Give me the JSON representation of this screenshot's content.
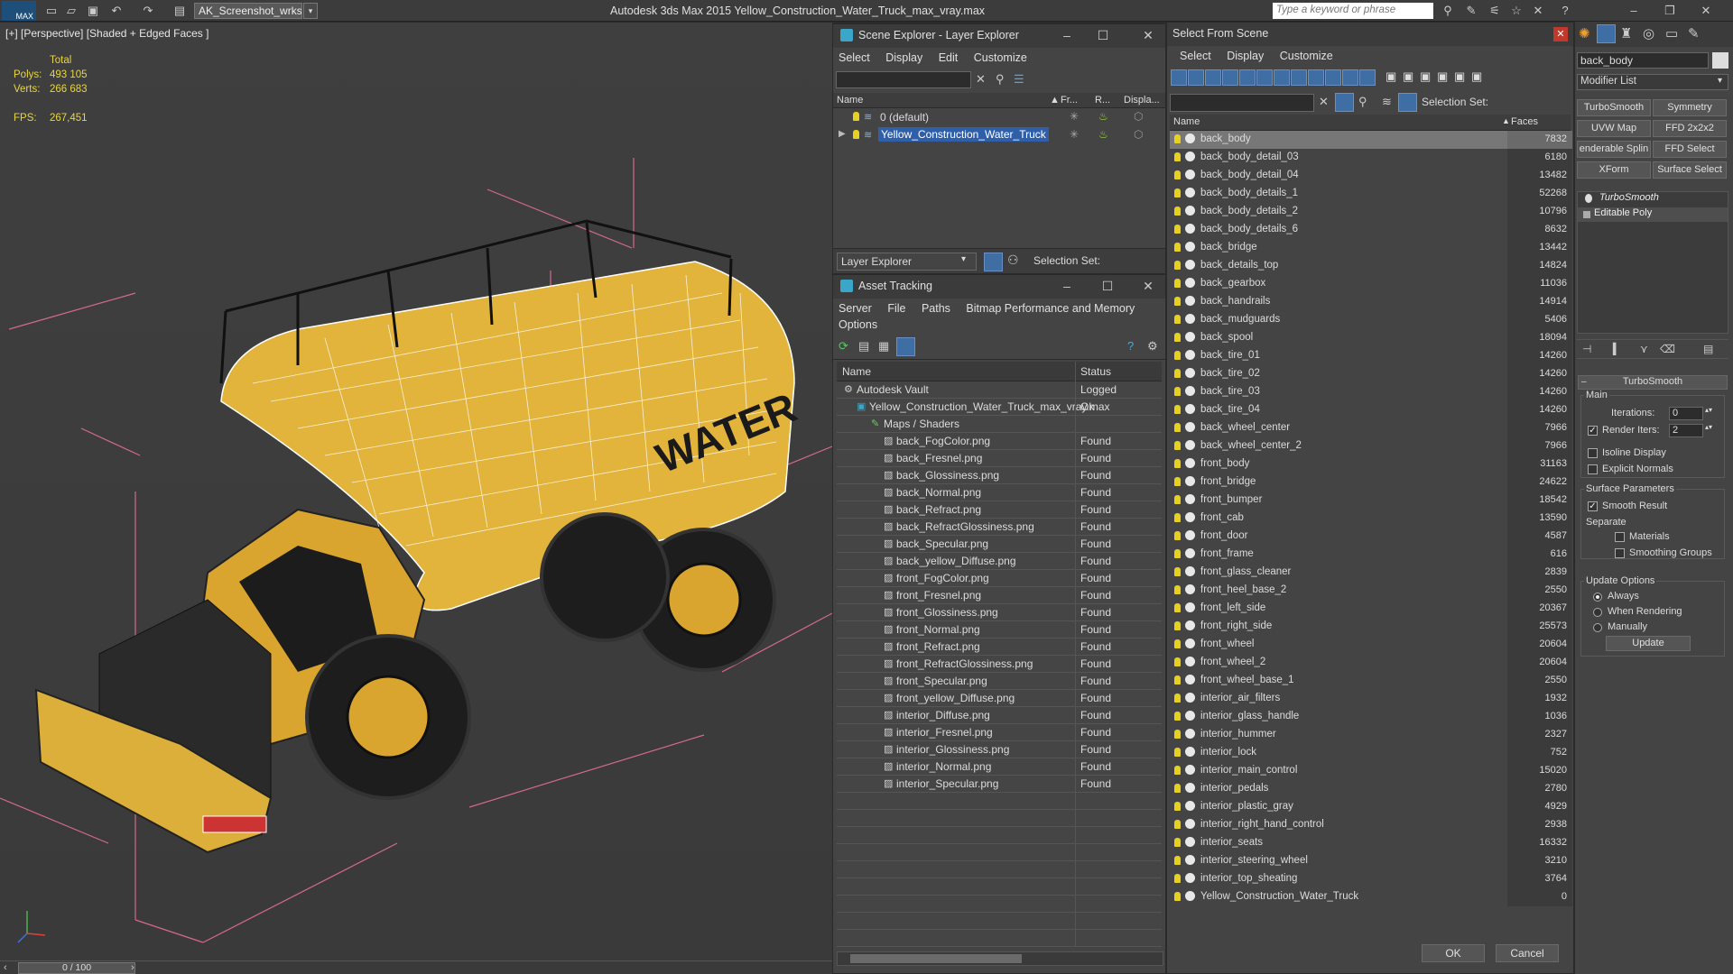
{
  "titlebar": {
    "logo_text": "MAX",
    "workspace": "AK_Screenshot_wrksp",
    "title": "Autodesk 3ds Max  2015     Yellow_Construction_Water_Truck_max_vray.max",
    "search_placeholder": "Type a keyword or phrase"
  },
  "viewport": {
    "label": "[+] [Perspective] [Shaded + Edged Faces ]",
    "stats": {
      "total_label": "Total",
      "polys_label": "Polys:",
      "polys": "493 105",
      "verts_label": "Verts:",
      "verts": "266 683",
      "fps_label": "FPS:",
      "fps": "267,451"
    },
    "tank_text": "WATER"
  },
  "timeline": {
    "frame": "0 / 100"
  },
  "scene_explorer": {
    "title": "Scene Explorer - Layer Explorer",
    "menu": [
      "Select",
      "Display",
      "Edit",
      "Customize"
    ],
    "columns": {
      "name": "Name",
      "freeze": "Fr...",
      "render": "R...",
      "display": "Displa..."
    },
    "rows": [
      {
        "name": "0 (default)",
        "selected": false
      },
      {
        "name": "Yellow_Construction_Water_Truck",
        "selected": true
      }
    ],
    "footer_dropdown": "Layer Explorer",
    "selection_set_label": "Selection Set:"
  },
  "asset_tracking": {
    "title": "Asset Tracking",
    "menu": [
      "Server",
      "File",
      "Paths",
      "Bitmap Performance and Memory",
      "Options"
    ],
    "columns": {
      "name": "Name",
      "status": "Status"
    },
    "rows": [
      {
        "name": "Autodesk Vault",
        "status": "Logged",
        "level": 0
      },
      {
        "name": "Yellow_Construction_Water_Truck_max_vray.max",
        "status": "Ok",
        "level": 1
      },
      {
        "name": "Maps / Shaders",
        "status": "",
        "level": 2
      },
      {
        "name": "back_FogColor.png",
        "status": "Found",
        "level": 3
      },
      {
        "name": "back_Fresnel.png",
        "status": "Found",
        "level": 3
      },
      {
        "name": "back_Glossiness.png",
        "status": "Found",
        "level": 3
      },
      {
        "name": "back_Normal.png",
        "status": "Found",
        "level": 3
      },
      {
        "name": "back_Refract.png",
        "status": "Found",
        "level": 3
      },
      {
        "name": "back_RefractGlossiness.png",
        "status": "Found",
        "level": 3
      },
      {
        "name": "back_Specular.png",
        "status": "Found",
        "level": 3
      },
      {
        "name": "back_yellow_Diffuse.png",
        "status": "Found",
        "level": 3
      },
      {
        "name": "front_FogColor.png",
        "status": "Found",
        "level": 3
      },
      {
        "name": "front_Fresnel.png",
        "status": "Found",
        "level": 3
      },
      {
        "name": "front_Glossiness.png",
        "status": "Found",
        "level": 3
      },
      {
        "name": "front_Normal.png",
        "status": "Found",
        "level": 3
      },
      {
        "name": "front_Refract.png",
        "status": "Found",
        "level": 3
      },
      {
        "name": "front_RefractGlossiness.png",
        "status": "Found",
        "level": 3
      },
      {
        "name": "front_Specular.png",
        "status": "Found",
        "level": 3
      },
      {
        "name": "front_yellow_Diffuse.png",
        "status": "Found",
        "level": 3
      },
      {
        "name": "interior_Diffuse.png",
        "status": "Found",
        "level": 3
      },
      {
        "name": "interior_Fresnel.png",
        "status": "Found",
        "level": 3
      },
      {
        "name": "interior_Glossiness.png",
        "status": "Found",
        "level": 3
      },
      {
        "name": "interior_Normal.png",
        "status": "Found",
        "level": 3
      },
      {
        "name": "interior_Specular.png",
        "status": "Found",
        "level": 3
      }
    ]
  },
  "select_from_scene": {
    "title": "Select From Scene",
    "menu": [
      "Select",
      "Display",
      "Customize"
    ],
    "selection_set_label": "Selection Set:",
    "columns": {
      "name": "Name",
      "faces": "Faces"
    },
    "rows": [
      {
        "name": "back_body",
        "faces": "7832"
      },
      {
        "name": "back_body_detail_03",
        "faces": "6180"
      },
      {
        "name": "back_body_detail_04",
        "faces": "13482"
      },
      {
        "name": "back_body_details_1",
        "faces": "52268"
      },
      {
        "name": "back_body_details_2",
        "faces": "10796"
      },
      {
        "name": "back_body_details_6",
        "faces": "8632"
      },
      {
        "name": "back_bridge",
        "faces": "13442"
      },
      {
        "name": "back_details_top",
        "faces": "14824"
      },
      {
        "name": "back_gearbox",
        "faces": "11036"
      },
      {
        "name": "back_handrails",
        "faces": "14914"
      },
      {
        "name": "back_mudguards",
        "faces": "5406"
      },
      {
        "name": "back_spool",
        "faces": "18094"
      },
      {
        "name": "back_tire_01",
        "faces": "14260"
      },
      {
        "name": "back_tire_02",
        "faces": "14260"
      },
      {
        "name": "back_tire_03",
        "faces": "14260"
      },
      {
        "name": "back_tire_04",
        "faces": "14260"
      },
      {
        "name": "back_wheel_center",
        "faces": "7966"
      },
      {
        "name": "back_wheel_center_2",
        "faces": "7966"
      },
      {
        "name": "front_body",
        "faces": "31163"
      },
      {
        "name": "front_bridge",
        "faces": "24622"
      },
      {
        "name": "front_bumper",
        "faces": "18542"
      },
      {
        "name": "front_cab",
        "faces": "13590"
      },
      {
        "name": "front_door",
        "faces": "4587"
      },
      {
        "name": "front_frame",
        "faces": "616"
      },
      {
        "name": "front_glass_cleaner",
        "faces": "2839"
      },
      {
        "name": "front_heel_base_2",
        "faces": "2550"
      },
      {
        "name": "front_left_side",
        "faces": "20367"
      },
      {
        "name": "front_right_side",
        "faces": "25573"
      },
      {
        "name": "front_wheel",
        "faces": "20604"
      },
      {
        "name": "front_wheel_2",
        "faces": "20604"
      },
      {
        "name": "front_wheel_base_1",
        "faces": "2550"
      },
      {
        "name": "interior_air_filters",
        "faces": "1932"
      },
      {
        "name": "interior_glass_handle",
        "faces": "1036"
      },
      {
        "name": "interior_hummer",
        "faces": "2327"
      },
      {
        "name": "interior_lock",
        "faces": "752"
      },
      {
        "name": "interior_main_control",
        "faces": "15020"
      },
      {
        "name": "interior_pedals",
        "faces": "2780"
      },
      {
        "name": "interior_plastic_gray",
        "faces": "4929"
      },
      {
        "name": "interior_right_hand_control",
        "faces": "2938"
      },
      {
        "name": "interior_seats",
        "faces": "16332"
      },
      {
        "name": "interior_steering_wheel",
        "faces": "3210"
      },
      {
        "name": "interior_top_sheating",
        "faces": "3764"
      },
      {
        "name": "Yellow_Construction_Water_Truck",
        "faces": "0"
      }
    ],
    "ok_label": "OK",
    "cancel_label": "Cancel"
  },
  "command_panel": {
    "object_name": "back_body",
    "modifier_list": "Modifier List",
    "mod_buttons": [
      "TurboSmooth",
      "Symmetry",
      "UVW Map",
      "FFD 2x2x2",
      "enderable Splin",
      "FFD Select",
      "XForm",
      "Surface Select"
    ],
    "stack": [
      "TurboSmooth",
      "Editable Poly"
    ],
    "rollout_title": "TurboSmooth",
    "main_label": "Main",
    "iterations_label": "Iterations:",
    "iterations_value": "0",
    "render_iters_label": "Render Iters:",
    "render_iters_value": "2",
    "isoline_label": "Isoline Display",
    "explicit_normals_label": "Explicit Normals",
    "surface_params_label": "Surface Parameters",
    "smooth_result_label": "Smooth Result",
    "separate_label": "Separate",
    "materials_label": "Materials",
    "smoothing_groups_label": "Smoothing Groups",
    "update_options_label": "Update Options",
    "always_label": "Always",
    "when_rendering_label": "When Rendering",
    "manually_label": "Manually",
    "update_button": "Update"
  },
  "colors": {
    "accent": "#3f6ea5",
    "truck_yellow": "#e3b43c",
    "stats_yellow": "#e8d640",
    "selection": "#2f5fa8"
  }
}
